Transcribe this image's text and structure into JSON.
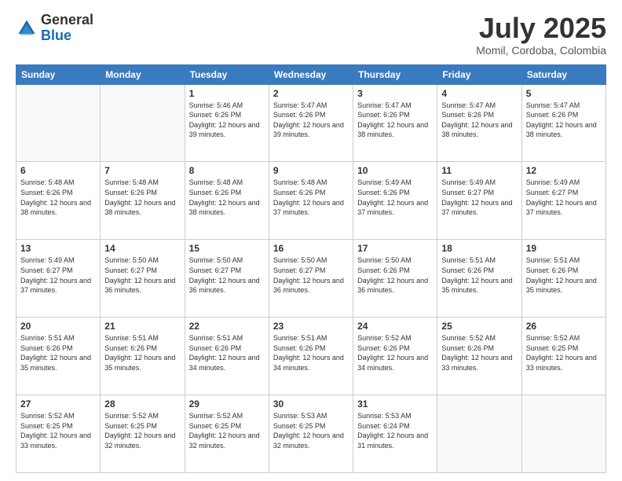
{
  "header": {
    "logo_general": "General",
    "logo_blue": "Blue",
    "month_title": "July 2025",
    "location": "Momil, Cordoba, Colombia"
  },
  "weekdays": [
    "Sunday",
    "Monday",
    "Tuesday",
    "Wednesday",
    "Thursday",
    "Friday",
    "Saturday"
  ],
  "weeks": [
    [
      {
        "day": "",
        "sunrise": "",
        "sunset": "",
        "daylight": ""
      },
      {
        "day": "",
        "sunrise": "",
        "sunset": "",
        "daylight": ""
      },
      {
        "day": "1",
        "sunrise": "Sunrise: 5:46 AM",
        "sunset": "Sunset: 6:26 PM",
        "daylight": "Daylight: 12 hours and 39 minutes."
      },
      {
        "day": "2",
        "sunrise": "Sunrise: 5:47 AM",
        "sunset": "Sunset: 6:26 PM",
        "daylight": "Daylight: 12 hours and 39 minutes."
      },
      {
        "day": "3",
        "sunrise": "Sunrise: 5:47 AM",
        "sunset": "Sunset: 6:26 PM",
        "daylight": "Daylight: 12 hours and 38 minutes."
      },
      {
        "day": "4",
        "sunrise": "Sunrise: 5:47 AM",
        "sunset": "Sunset: 6:26 PM",
        "daylight": "Daylight: 12 hours and 38 minutes."
      },
      {
        "day": "5",
        "sunrise": "Sunrise: 5:47 AM",
        "sunset": "Sunset: 6:26 PM",
        "daylight": "Daylight: 12 hours and 38 minutes."
      }
    ],
    [
      {
        "day": "6",
        "sunrise": "Sunrise: 5:48 AM",
        "sunset": "Sunset: 6:26 PM",
        "daylight": "Daylight: 12 hours and 38 minutes."
      },
      {
        "day": "7",
        "sunrise": "Sunrise: 5:48 AM",
        "sunset": "Sunset: 6:26 PM",
        "daylight": "Daylight: 12 hours and 38 minutes."
      },
      {
        "day": "8",
        "sunrise": "Sunrise: 5:48 AM",
        "sunset": "Sunset: 6:26 PM",
        "daylight": "Daylight: 12 hours and 38 minutes."
      },
      {
        "day": "9",
        "sunrise": "Sunrise: 5:48 AM",
        "sunset": "Sunset: 6:26 PM",
        "daylight": "Daylight: 12 hours and 37 minutes."
      },
      {
        "day": "10",
        "sunrise": "Sunrise: 5:49 AM",
        "sunset": "Sunset: 6:26 PM",
        "daylight": "Daylight: 12 hours and 37 minutes."
      },
      {
        "day": "11",
        "sunrise": "Sunrise: 5:49 AM",
        "sunset": "Sunset: 6:27 PM",
        "daylight": "Daylight: 12 hours and 37 minutes."
      },
      {
        "day": "12",
        "sunrise": "Sunrise: 5:49 AM",
        "sunset": "Sunset: 6:27 PM",
        "daylight": "Daylight: 12 hours and 37 minutes."
      }
    ],
    [
      {
        "day": "13",
        "sunrise": "Sunrise: 5:49 AM",
        "sunset": "Sunset: 6:27 PM",
        "daylight": "Daylight: 12 hours and 37 minutes."
      },
      {
        "day": "14",
        "sunrise": "Sunrise: 5:50 AM",
        "sunset": "Sunset: 6:27 PM",
        "daylight": "Daylight: 12 hours and 36 minutes."
      },
      {
        "day": "15",
        "sunrise": "Sunrise: 5:50 AM",
        "sunset": "Sunset: 6:27 PM",
        "daylight": "Daylight: 12 hours and 36 minutes."
      },
      {
        "day": "16",
        "sunrise": "Sunrise: 5:50 AM",
        "sunset": "Sunset: 6:27 PM",
        "daylight": "Daylight: 12 hours and 36 minutes."
      },
      {
        "day": "17",
        "sunrise": "Sunrise: 5:50 AM",
        "sunset": "Sunset: 6:26 PM",
        "daylight": "Daylight: 12 hours and 36 minutes."
      },
      {
        "day": "18",
        "sunrise": "Sunrise: 5:51 AM",
        "sunset": "Sunset: 6:26 PM",
        "daylight": "Daylight: 12 hours and 35 minutes."
      },
      {
        "day": "19",
        "sunrise": "Sunrise: 5:51 AM",
        "sunset": "Sunset: 6:26 PM",
        "daylight": "Daylight: 12 hours and 35 minutes."
      }
    ],
    [
      {
        "day": "20",
        "sunrise": "Sunrise: 5:51 AM",
        "sunset": "Sunset: 6:26 PM",
        "daylight": "Daylight: 12 hours and 35 minutes."
      },
      {
        "day": "21",
        "sunrise": "Sunrise: 5:51 AM",
        "sunset": "Sunset: 6:26 PM",
        "daylight": "Daylight: 12 hours and 35 minutes."
      },
      {
        "day": "22",
        "sunrise": "Sunrise: 5:51 AM",
        "sunset": "Sunset: 6:26 PM",
        "daylight": "Daylight: 12 hours and 34 minutes."
      },
      {
        "day": "23",
        "sunrise": "Sunrise: 5:51 AM",
        "sunset": "Sunset: 6:26 PM",
        "daylight": "Daylight: 12 hours and 34 minutes."
      },
      {
        "day": "24",
        "sunrise": "Sunrise: 5:52 AM",
        "sunset": "Sunset: 6:26 PM",
        "daylight": "Daylight: 12 hours and 34 minutes."
      },
      {
        "day": "25",
        "sunrise": "Sunrise: 5:52 AM",
        "sunset": "Sunset: 6:26 PM",
        "daylight": "Daylight: 12 hours and 33 minutes."
      },
      {
        "day": "26",
        "sunrise": "Sunrise: 5:52 AM",
        "sunset": "Sunset: 6:25 PM",
        "daylight": "Daylight: 12 hours and 33 minutes."
      }
    ],
    [
      {
        "day": "27",
        "sunrise": "Sunrise: 5:52 AM",
        "sunset": "Sunset: 6:25 PM",
        "daylight": "Daylight: 12 hours and 33 minutes."
      },
      {
        "day": "28",
        "sunrise": "Sunrise: 5:52 AM",
        "sunset": "Sunset: 6:25 PM",
        "daylight": "Daylight: 12 hours and 32 minutes."
      },
      {
        "day": "29",
        "sunrise": "Sunrise: 5:52 AM",
        "sunset": "Sunset: 6:25 PM",
        "daylight": "Daylight: 12 hours and 32 minutes."
      },
      {
        "day": "30",
        "sunrise": "Sunrise: 5:53 AM",
        "sunset": "Sunset: 6:25 PM",
        "daylight": "Daylight: 12 hours and 32 minutes."
      },
      {
        "day": "31",
        "sunrise": "Sunrise: 5:53 AM",
        "sunset": "Sunset: 6:24 PM",
        "daylight": "Daylight: 12 hours and 31 minutes."
      },
      {
        "day": "",
        "sunrise": "",
        "sunset": "",
        "daylight": ""
      },
      {
        "day": "",
        "sunrise": "",
        "sunset": "",
        "daylight": ""
      }
    ]
  ]
}
